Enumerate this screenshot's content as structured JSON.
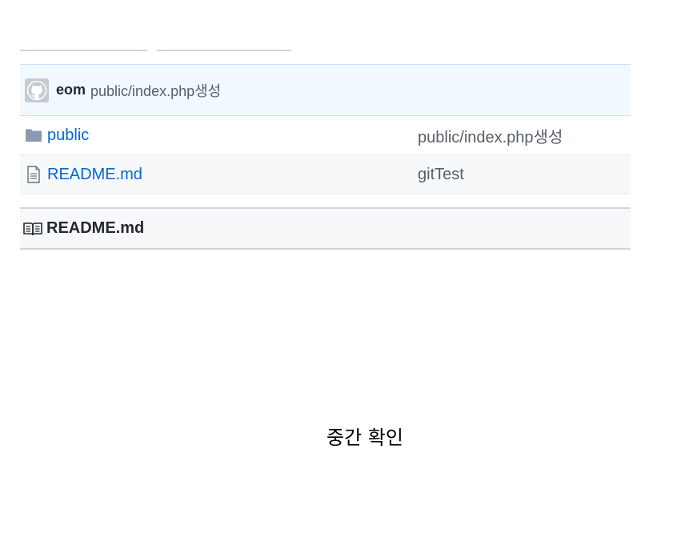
{
  "commit": {
    "author": "eom",
    "message": "public/index.php생성"
  },
  "files": [
    {
      "icon": "folder-icon",
      "name": "public",
      "commit_message": "public/index.php생성"
    },
    {
      "icon": "file-icon",
      "name": "README.md",
      "commit_message": "gitTest"
    }
  ],
  "readme": {
    "title": "README.md",
    "content": "중간 확인"
  },
  "colors": {
    "link": "#0366d6",
    "commit_bar_bg": "#f1f8ff",
    "folder": "#79b8ff"
  }
}
